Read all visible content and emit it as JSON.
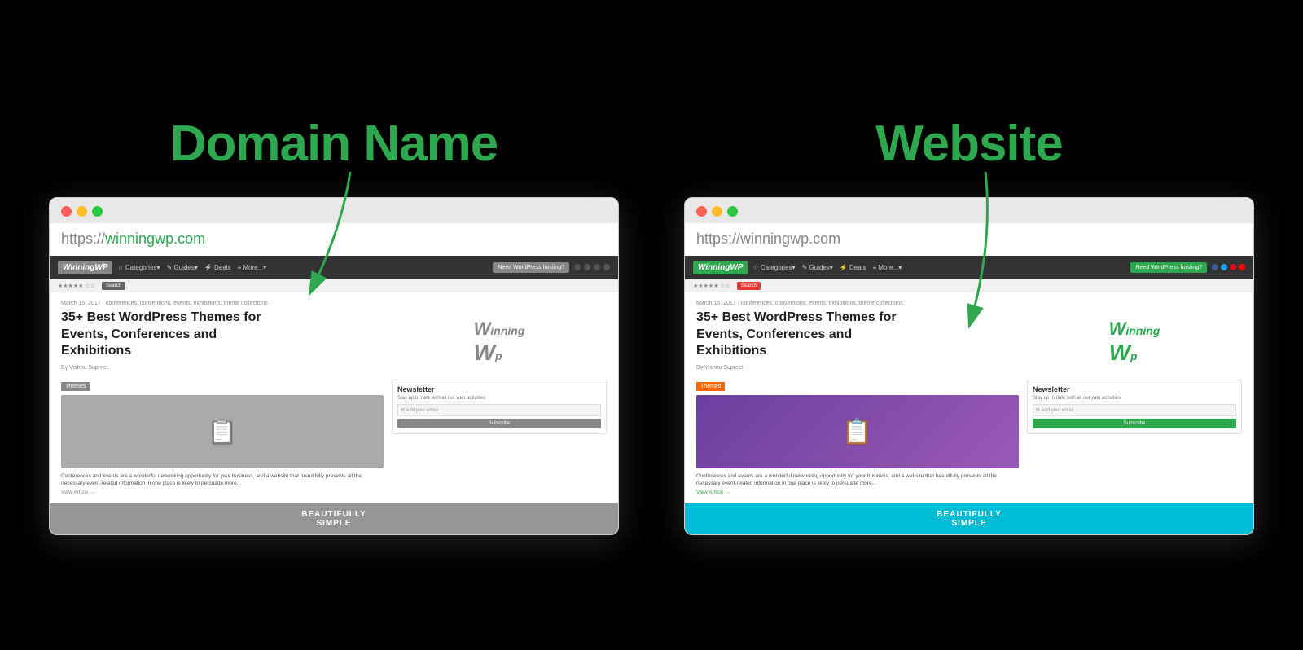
{
  "left_panel": {
    "title": "Domain Name",
    "url_gray": "https://",
    "url_green": "winningwp.com",
    "site_date": "March 15, 2017 · conferences, conventions, events, exhibitions, theme collections",
    "site_title": "35+ Best WordPress Themes for Events, Conferences and Exhibitions",
    "site_author": "By Vishnu Supreet",
    "themes_label": "Themes",
    "excerpt": "Conferences and events are a wonderful networking opportunity for your business, and a website\nthat beautifully presents all the necessary event-related information in one place is likely to\npersuade more...",
    "view_article": "View Article →",
    "newsletter_title": "Newsletter",
    "newsletter_desc": "Stay up to date with all our web activities",
    "newsletter_placeholder": "✉ Add your email",
    "subscribe_label": "Subscribe",
    "beautifully_label": "BEAUTIFULLY\nSIMPLE"
  },
  "right_panel": {
    "title": "Website",
    "url_gray": "https://winningwp.com",
    "site_date": "March 15, 2017 · conferences, conventions, events, exhibitions, theme collections",
    "site_title": "35+ Best WordPress Themes for Events, Conferences and Exhibitions",
    "site_author": "By Vishnu Supreet",
    "themes_label": "Themes",
    "excerpt": "Conferences and events are a wonderful networking opportunity for your business, and a website\nthat beautifully presents all the necessary event-related information in one place is likely to\npersuade more...",
    "view_article": "View Article →",
    "newsletter_title": "Newsletter",
    "newsletter_desc": "Stay up to date with all our web activities",
    "newsletter_placeholder": "✉ Add your email",
    "subscribe_label": "Subscribe",
    "beautifully_label": "BEAUTIFULLY\nSIMPLE"
  },
  "colors": {
    "green": "#2ea84f",
    "arrow": "#2ea84f"
  }
}
